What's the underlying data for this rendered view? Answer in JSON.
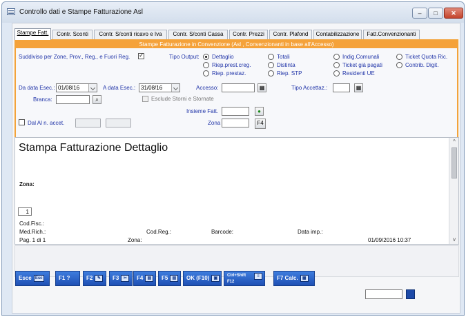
{
  "window": {
    "title": "Controllo dati e Stampe Fatturazione Asl"
  },
  "tabs": [
    {
      "label": "Stampe Fatt.",
      "active": true
    },
    {
      "label": "Contr. Sconti"
    },
    {
      "label": "Contr. S/conti ricavo e Iva"
    },
    {
      "label": "Contr. S/conti Cassa"
    },
    {
      "label": "Contr. Prezzi"
    },
    {
      "label": "Contr. Plafond"
    },
    {
      "label": "Contabilizzazione"
    },
    {
      "label": "Fatt.Convenzionanti"
    }
  ],
  "panel": {
    "banner": "Stampe Fatturazione in Convenzione (Asl , Convenzionanti in base all'Accesso)",
    "suddiviso_label": "Suddiviso per Zone, Prov., Reg., e Fuori Reg.",
    "suddiviso_checked": true,
    "tipo_output_label": "Tipo Output:",
    "radio_options": [
      {
        "label": "Dettaglio",
        "checked": true
      },
      {
        "label": "Riep.prest.creg."
      },
      {
        "label": "Riep. prestaz."
      },
      {
        "label": "Totali"
      },
      {
        "label": "Distinta"
      },
      {
        "label": "Riep. STP"
      },
      {
        "label": "Indig.Comunali"
      },
      {
        "label": "Ticket già pagati"
      },
      {
        "label": "Residenti UE"
      },
      {
        "label": "Ticket Quota Ric."
      },
      {
        "label": "Contrib. Digit."
      }
    ],
    "da_data_label": "Da data Esec.:",
    "da_data_value": "01/08/16",
    "a_data_label": "A data Esec.:",
    "a_data_value": "31/08/16",
    "accesso_label": "Accesso:",
    "accesso_value": "",
    "tipo_accettaz_label": "Tipo Accettaz.:",
    "tipo_accettaz_value": "",
    "branca_label": "Branca:",
    "branca_value": "",
    "escludi_label": "Esclude Storni e Stornate",
    "insieme_label": "Insieme Fatt.",
    "insieme_value": "",
    "dal_al_label": "Dal Al n. accet.",
    "zona_label": "Zona",
    "zona_value": "",
    "f4_label": "F4"
  },
  "report": {
    "title": "Stampa Fatturazione Dettaglio",
    "zona": "Zona:",
    "page_input": "1",
    "codfisc": "Cod.Fisc.:",
    "medrich": "Med.Rich.:",
    "codreg": "Cod.Reg.:",
    "barcode": "Barcode:",
    "dataimp": "Data imp.:",
    "pag": "Pag. 1 di 1",
    "zona_footer": "Zona:",
    "timestamp": "01/09/2016 10:37"
  },
  "footer_buttons": [
    {
      "label": "Esce",
      "icon": "Esc"
    },
    {
      "label": "F1 ?",
      "icon": ""
    },
    {
      "label": "F2",
      "icon": "✎"
    },
    {
      "label": "F3",
      "icon": "✂"
    },
    {
      "label": "F4",
      "icon": "▤"
    },
    {
      "label": "F5",
      "icon": "▤"
    },
    {
      "label": "OK (F10)",
      "icon": "▣"
    },
    {
      "label": "Ctrl+Shift F12",
      "icon": "≡"
    },
    {
      "label": "F7 Calc.",
      "icon": "▦"
    }
  ],
  "colors": {
    "accent": "#f5a23a",
    "label_blue": "#2034a8",
    "button_blue": "#1f50b5"
  }
}
